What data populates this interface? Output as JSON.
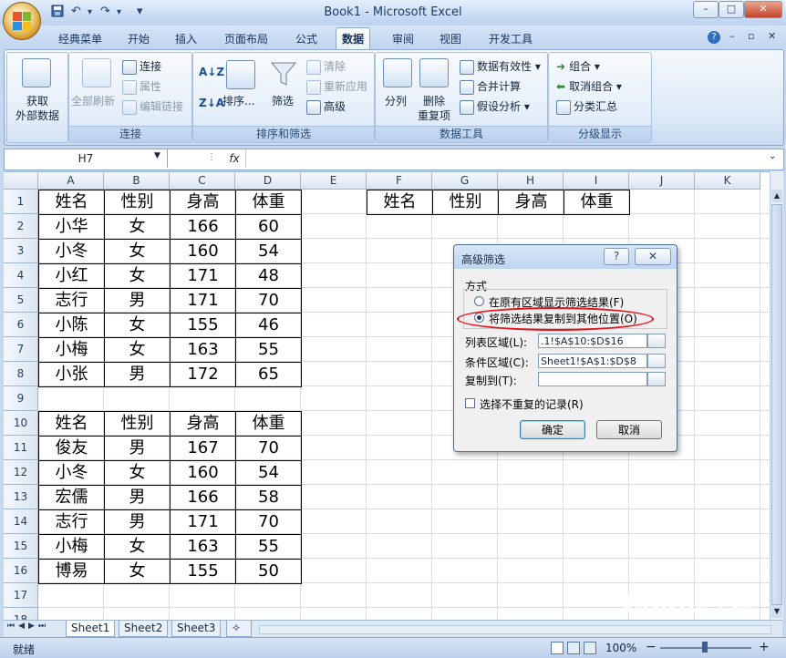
{
  "window": {
    "title": "Book1 - Microsoft Excel",
    "min_glyph": "–",
    "max_glyph": "□",
    "close_glyph": "✕"
  },
  "qat": {
    "save_icon": "save-icon",
    "undo_glyph": "↶",
    "redo_glyph": "↷",
    "customize_glyph": "▾"
  },
  "tabs": [
    "经典菜单",
    "开始",
    "插入",
    "页面布局",
    "公式",
    "数据",
    "审阅",
    "视图",
    "开发工具"
  ],
  "active_tab": "数据",
  "ribbon": {
    "get_external": {
      "line1": "获取",
      "line2": "外部数据"
    },
    "connections": {
      "refresh_all": "全部刷新",
      "connect": "连接",
      "properties": "属性",
      "edit_links": "编辑链接",
      "label": "连接"
    },
    "sort_filter": {
      "sort": "排序...",
      "filter": "筛选",
      "clear": "清除",
      "reapply": "重新应用",
      "advanced": "高级",
      "label": "排序和筛选"
    },
    "data_tools": {
      "text_to_columns": "分列",
      "remove_dup_1": "删除",
      "remove_dup_2": "重复项",
      "validation": "数据有效性",
      "consolidate": "合并计算",
      "what_if": "假设分析",
      "label": "数据工具"
    },
    "outline": {
      "group": "组合",
      "ungroup": "取消组合",
      "subtotal": "分类汇总",
      "label": "分级显示"
    }
  },
  "formula_bar": {
    "name_box": "H7",
    "fx": "fx",
    "value": ""
  },
  "columns": [
    "A",
    "B",
    "C",
    "D",
    "E",
    "F",
    "G",
    "H",
    "I",
    "J",
    "K"
  ],
  "rows": [
    "1",
    "2",
    "3",
    "4",
    "5",
    "6",
    "7",
    "8",
    "9",
    "10",
    "11",
    "12",
    "13",
    "14",
    "15",
    "16",
    "17",
    "18"
  ],
  "table1": {
    "header": [
      "姓名",
      "性别",
      "身高",
      "体重"
    ],
    "rows": [
      [
        "小华",
        "女",
        "166",
        "60"
      ],
      [
        "小冬",
        "女",
        "160",
        "54"
      ],
      [
        "小红",
        "女",
        "171",
        "48"
      ],
      [
        "志行",
        "男",
        "171",
        "70"
      ],
      [
        "小陈",
        "女",
        "155",
        "46"
      ],
      [
        "小梅",
        "女",
        "163",
        "55"
      ],
      [
        "小张",
        "男",
        "172",
        "65"
      ]
    ]
  },
  "table2": {
    "header": [
      "姓名",
      "性别",
      "身高",
      "体重"
    ],
    "rows": [
      [
        "俊友",
        "男",
        "167",
        "70"
      ],
      [
        "小冬",
        "女",
        "160",
        "54"
      ],
      [
        "宏儒",
        "男",
        "166",
        "58"
      ],
      [
        "志行",
        "男",
        "171",
        "70"
      ],
      [
        "小梅",
        "女",
        "163",
        "55"
      ],
      [
        "博易",
        "女",
        "155",
        "50"
      ]
    ]
  },
  "criteria_header": [
    "姓名",
    "性别",
    "身高",
    "体重"
  ],
  "sheets": [
    "Sheet1",
    "Sheet2",
    "Sheet3"
  ],
  "active_sheet": "Sheet1",
  "status": {
    "ready": "就绪",
    "zoom": "100%",
    "zoom_minus": "−",
    "zoom_plus": "+"
  },
  "dialog": {
    "title": "高级筛选",
    "help": "?",
    "close": "✕",
    "section": "方式",
    "option1": "在原有区域显示筛选结果(F)",
    "option2": "将筛选结果复制到其他位置(O)",
    "selected_option": 2,
    "list_range_label": "列表区域(L):",
    "list_range_value": ".1!$A$10:$D$16",
    "criteria_range_label": "条件区域(C):",
    "criteria_range_value": "Sheet1!$A$1:$D$8",
    "copy_to_label": "复制到(T):",
    "copy_to_value": "",
    "unique_label": "选择不重复的记录(R)",
    "unique_checked": false,
    "ok": "确定",
    "cancel": "取消"
  },
  "watermark": {
    "text": "Baidu经验",
    "url": "jingyan.baidu.com"
  },
  "colors": {
    "highlight_oval": "#e3141a",
    "ribbon_blue": "#c5d8ef"
  }
}
